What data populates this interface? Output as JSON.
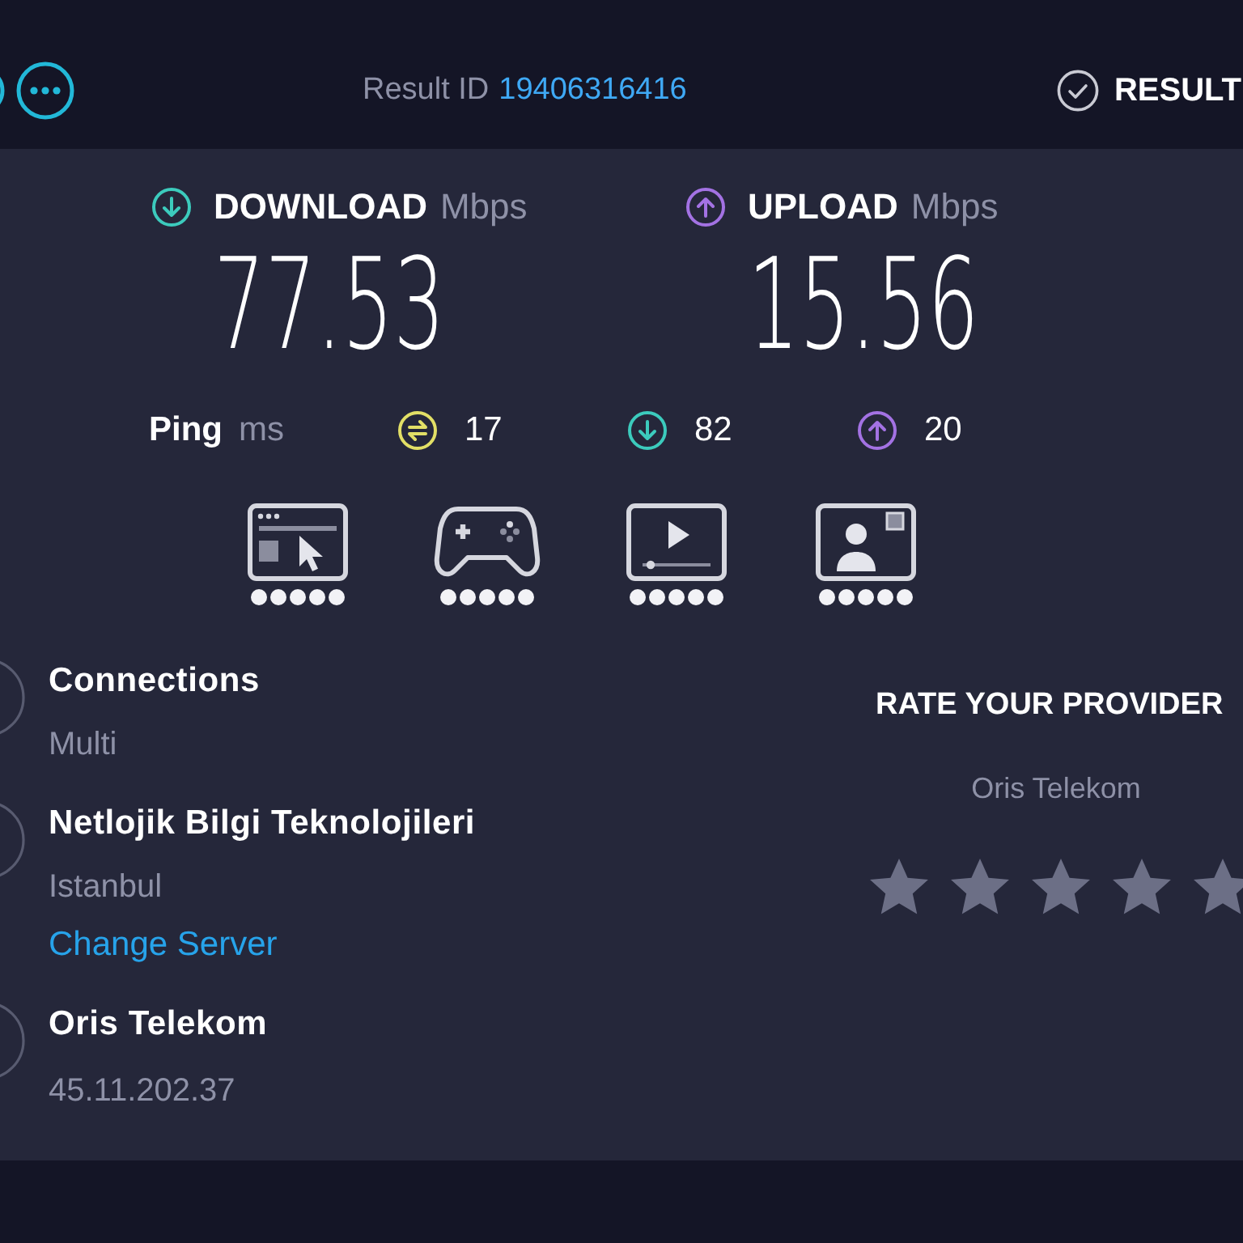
{
  "header": {
    "result_id_label": "Result ID",
    "result_id": "19406316416",
    "results_label": "RESULT"
  },
  "speeds": [
    {
      "kind": "download",
      "label": "DOWNLOAD",
      "unit": "Mbps",
      "value": "77.53"
    },
    {
      "kind": "upload",
      "label": "UPLOAD",
      "unit": "Mbps",
      "value": "15.56"
    }
  ],
  "ping": {
    "label": "Ping",
    "unit": "ms",
    "readings": [
      {
        "kind": "idle",
        "value": "17"
      },
      {
        "kind": "download",
        "value": "82"
      },
      {
        "kind": "upload",
        "value": "20"
      }
    ]
  },
  "activities": [
    {
      "kind": "browsing",
      "stars": 5
    },
    {
      "kind": "gaming",
      "stars": 5
    },
    {
      "kind": "streaming",
      "stars": 5
    },
    {
      "kind": "video_call",
      "stars": 5
    }
  ],
  "details": [
    {
      "title": "Connections",
      "value": "Multi"
    },
    {
      "title": "Netlojik Bilgi Teknolojileri",
      "value": "Istanbul",
      "link": "Change Server"
    },
    {
      "title": "Oris Telekom",
      "value": "45.11.202.37"
    }
  ],
  "rating": {
    "title": "RATE YOUR PROVIDER",
    "provider": "Oris Telekom"
  }
}
